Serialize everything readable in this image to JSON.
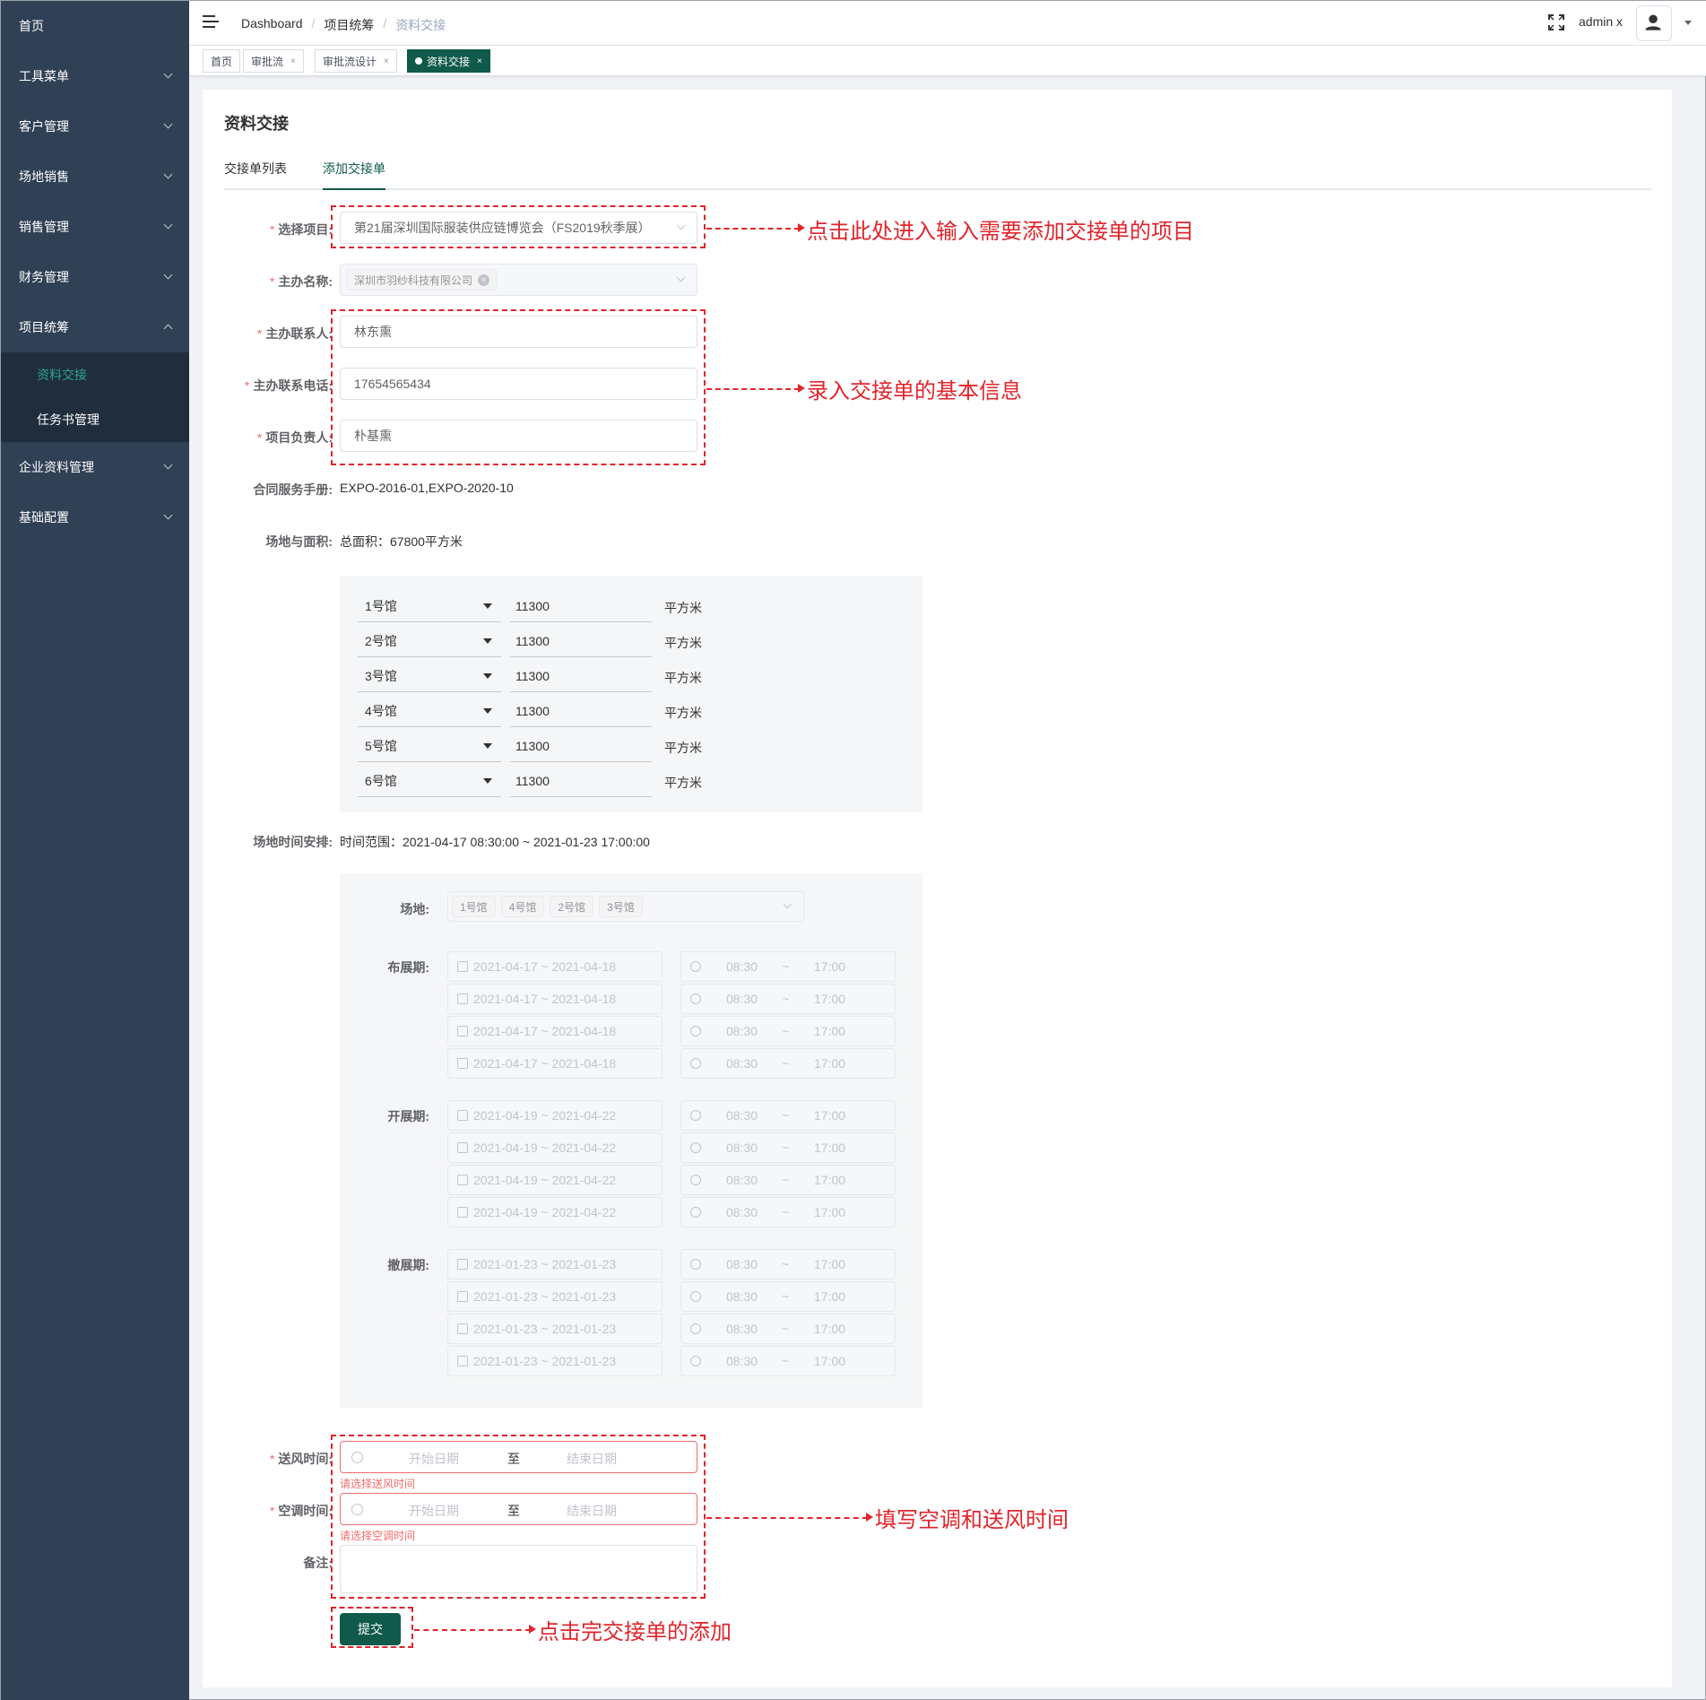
{
  "sidebar": {
    "items": [
      {
        "label": "首页"
      },
      {
        "label": "工具菜单"
      },
      {
        "label": "客户管理"
      },
      {
        "label": "场地销售"
      },
      {
        "label": "销售管理"
      },
      {
        "label": "财务管理"
      },
      {
        "label": "项目统筹"
      },
      {
        "label": "企业资料管理"
      },
      {
        "label": "基础配置"
      }
    ],
    "sub_items": [
      {
        "label": "资料交接"
      },
      {
        "label": "任务书管理"
      }
    ]
  },
  "header": {
    "breadcrumb": [
      "Dashboard",
      "项目统筹",
      "资料交接"
    ],
    "separator": "/",
    "user": "admin x"
  },
  "tags": [
    {
      "label": "首页"
    },
    {
      "label": "审批流"
    },
    {
      "label": "审批流设计"
    },
    {
      "label": "资料交接"
    }
  ],
  "tag_close": "×",
  "page": {
    "title": "资料交接",
    "tabs": [
      "交接单列表",
      "添加交接单"
    ]
  },
  "form": {
    "required_mark": "*",
    "project_label": "选择项目:",
    "project_value": "第21届深圳国际服装供应链博览会（FS2019秋季展）",
    "host_label": "主办名称:",
    "host_chip": "深圳市羽纱科技有限公司",
    "contact_label": "主办联系人:",
    "contact_value": "林东熏",
    "phone_label": "主办联系电话:",
    "phone_value": "17654565434",
    "manager_label": "项目负责人:",
    "manager_value": "朴基熏",
    "manual_label": "合同服务手册:",
    "manual_value": "EXPO-2016-01,EXPO-2020-10",
    "area_label": "场地与面积:",
    "area_total": "总面积：67800平方米",
    "halls": [
      {
        "hall": "1号馆",
        "area": "11300",
        "unit": "平方米"
      },
      {
        "hall": "2号馆",
        "area": "11300",
        "unit": "平方米"
      },
      {
        "hall": "3号馆",
        "area": "11300",
        "unit": "平方米"
      },
      {
        "hall": "4号馆",
        "area": "11300",
        "unit": "平方米"
      },
      {
        "hall": "5号馆",
        "area": "11300",
        "unit": "平方米"
      },
      {
        "hall": "6号馆",
        "area": "11300",
        "unit": "平方米"
      }
    ],
    "time_label": "场地时间安排:",
    "time_range": "时间范围：2021-04-17 08:30:00 ~ 2021-01-23 17:00:00",
    "venue_label": "场地:",
    "venue_chips": [
      "1号馆",
      "4号馆",
      "2号馆",
      "3号馆"
    ],
    "periods": [
      {
        "label": "布展期:",
        "date": "2021-04-17 ~ 2021-04-18",
        "start": "08:30",
        "tilde": "~",
        "end": "17:00"
      },
      {
        "label": "开展期:",
        "date": "2021-04-19 ~ 2021-04-22",
        "start": "08:30",
        "tilde": "~",
        "end": "17:00"
      },
      {
        "label": "撤展期:",
        "date": "2021-01-23 ~ 2021-01-23",
        "start": "08:30",
        "tilde": "~",
        "end": "17:00"
      }
    ],
    "air_label": "送风时间:",
    "ac_label": "空调时间:",
    "start_placeholder": "开始日期",
    "to_text": "至",
    "end_placeholder": "结束日期",
    "air_error": "请选择送风时间",
    "ac_error": "请选择空调时间",
    "remark_label": "备注:",
    "submit": "提交"
  },
  "annotations": {
    "project": "点击此处进入输入需要添加交接单的项目",
    "basic": "录入交接单的基本信息",
    "time": "填写空调和送风时间",
    "submit": "点击完交接单的添加"
  },
  "colors": {
    "sidebar": "#304156",
    "accent": "#0f5a4a",
    "annotation": "#e0252b",
    "error": "#f56c6c"
  }
}
